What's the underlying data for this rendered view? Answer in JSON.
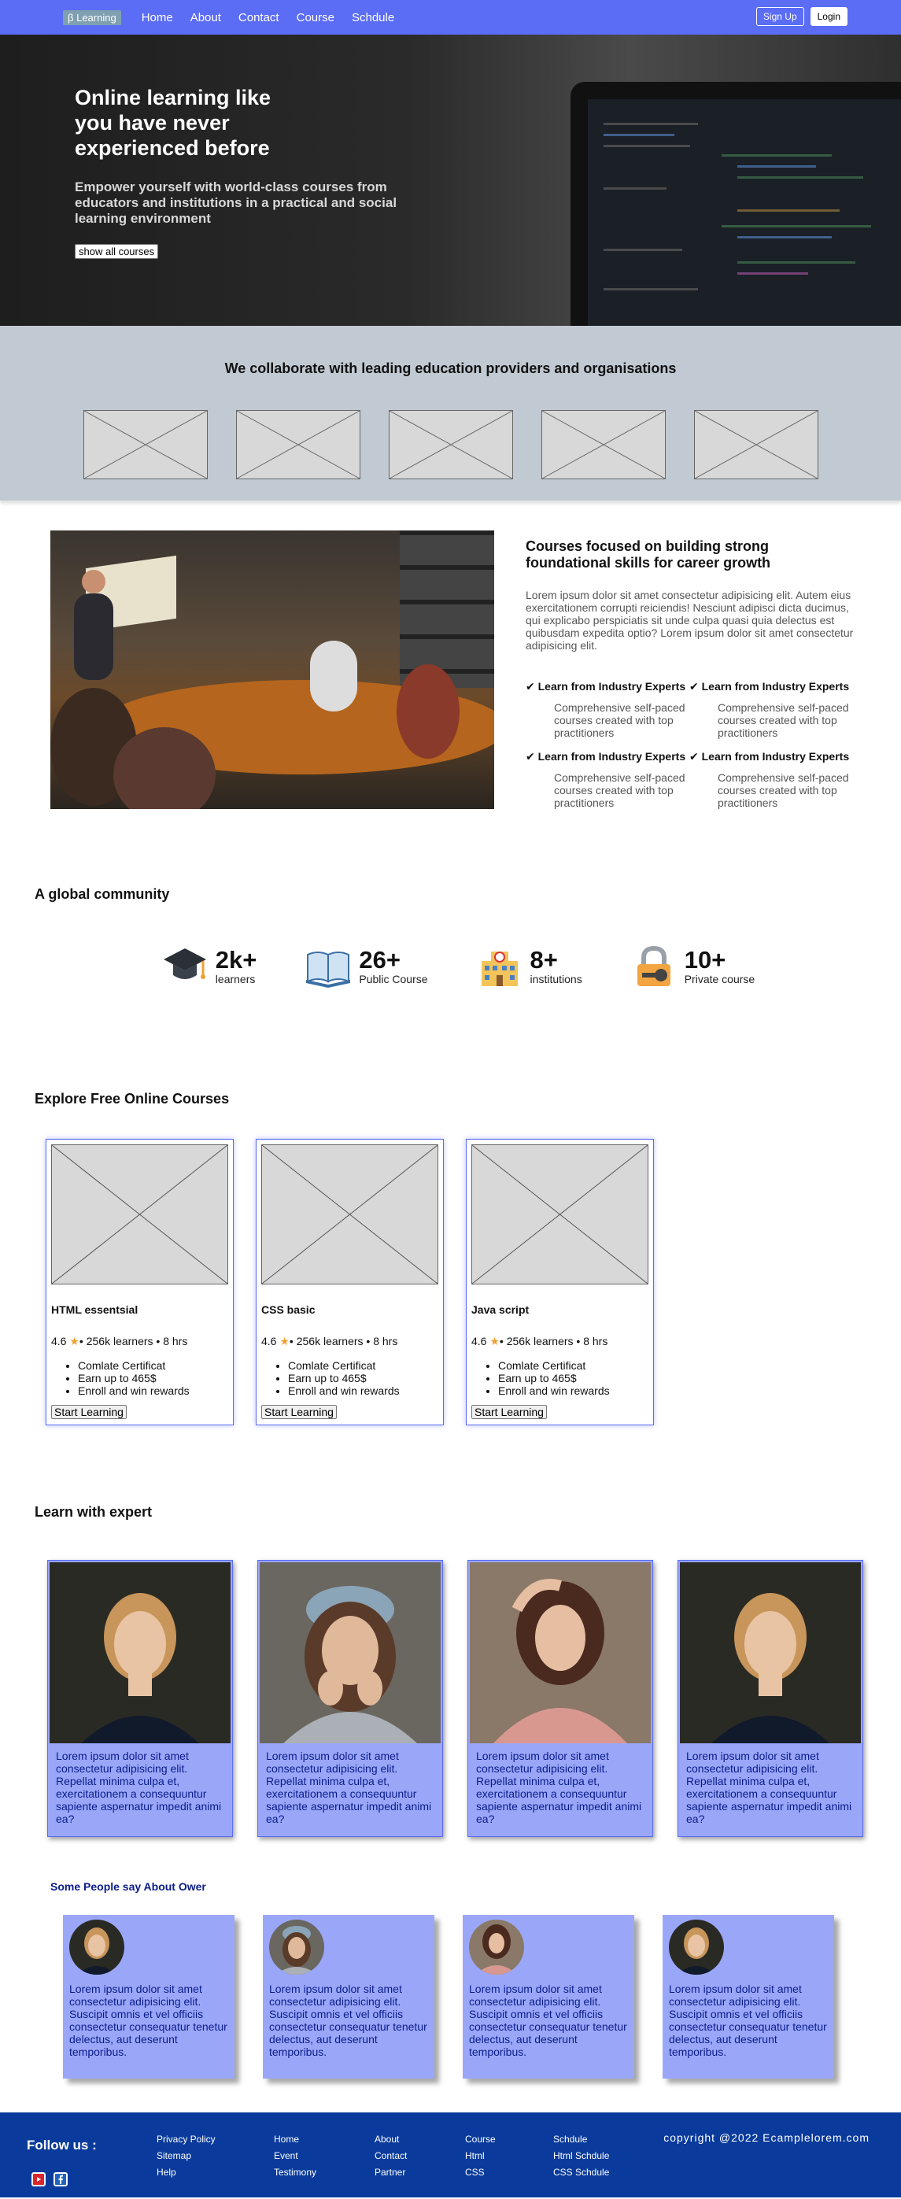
{
  "nav": {
    "logo": "β Learning",
    "links": [
      "Home",
      "About",
      "Contact",
      "Course",
      "Schdule"
    ],
    "signup": "Sign Up",
    "login": "Login"
  },
  "hero": {
    "title": "Online learning like you have never experienced before",
    "subtitle": "Empower yourself with world-class courses from educators and institutions in a practical and social learning environment",
    "button": "show all courses"
  },
  "partners": {
    "title": "We collaborate with leading education providers and organisations"
  },
  "focus": {
    "title": "Courses focused on building strong foundational skills for career growth",
    "paragraph": "Lorem ipsum dolor sit amet consectetur adipisicing elit. Autem eius exercitationem corrupti reiciendis! Nesciunt adipisci dicta ducimus, qui explicabo perspiciatis sit unde culpa quasi quia delectus est quibusdam expedita optio? Lorem ipsum dolor sit amet consectetur adipisicing elit.",
    "features": [
      {
        "title": "✔ Learn from Industry Experts",
        "desc": "Comprehensive self-paced courses created with top practitioners"
      },
      {
        "title": "✔ Learn from Industry Experts",
        "desc": "Comprehensive self-paced courses created with top practitioners"
      },
      {
        "title": "✔ Learn from Industry Experts",
        "desc": "Comprehensive self-paced courses created with top practitioners"
      },
      {
        "title": "✔ Learn from Industry Experts",
        "desc": "Comprehensive self-paced courses created with top practitioners"
      }
    ]
  },
  "community": {
    "title": "A global community",
    "stats": [
      {
        "num": "2k+",
        "label": "learners",
        "icon": "graduation-cap-icon"
      },
      {
        "num": "26+",
        "label": "Public Course",
        "icon": "open-book-icon"
      },
      {
        "num": "8+",
        "label": "institutions",
        "icon": "school-building-icon"
      },
      {
        "num": "10+",
        "label": "Private course",
        "icon": "locked-key-icon"
      }
    ]
  },
  "free_courses": {
    "title": "Explore Free Online Courses",
    "courses": [
      {
        "title": "HTML essentsial",
        "rating_pre": "4.6 ",
        "star": "★",
        "rating_post": "• 256k learners • 8 hrs",
        "perks": [
          "Comlate Certificat",
          "Earn up to 465$",
          "Enroll and win rewards"
        ],
        "button": "Start Learning"
      },
      {
        "title": "CSS basic",
        "rating_pre": "4.6 ",
        "star": "★",
        "rating_post": "• 256k learners • 8 hrs",
        "perks": [
          "Comlate Certificat",
          "Earn up to 465$",
          "Enroll and win rewards"
        ],
        "button": "Start Learning"
      },
      {
        "title": "Java script",
        "rating_pre": "4.6 ",
        "star": "★",
        "rating_post": "• 256k learners • 8 hrs",
        "perks": [
          "Comlate Certificat",
          "Earn up to 465$",
          "Enroll and win rewards"
        ],
        "button": "Start Learning"
      }
    ]
  },
  "expert": {
    "title": "Learn with expert",
    "cards": [
      {
        "text": "Lorem ipsum dolor sit amet consectetur adipisicing elit. Repellat minima culpa et, exercitationem a consequuntur sapiente aspernatur impedit animi ea?"
      },
      {
        "text": "Lorem ipsum dolor sit amet consectetur adipisicing elit. Repellat minima culpa et, exercitationem a consequuntur sapiente aspernatur impedit animi ea?"
      },
      {
        "text": "Lorem ipsum dolor sit amet consectetur adipisicing elit. Repellat minima culpa et, exercitationem a consequuntur sapiente aspernatur impedit animi ea?"
      },
      {
        "text": "Lorem ipsum dolor sit amet consectetur adipisicing elit. Repellat minima culpa et, exercitationem a consequuntur sapiente aspernatur impedit animi ea?"
      }
    ]
  },
  "testimonials": {
    "title": "Some People say About Ower",
    "cards": [
      {
        "text": "Lorem ipsum dolor sit amet consectetur adipisicing elit. Suscipit omnis et vel officiis consectetur consequatur tenetur delectus, aut deserunt temporibus."
      },
      {
        "text": "Lorem ipsum dolor sit amet consectetur adipisicing elit. Suscipit omnis et vel officiis consectetur consequatur tenetur delectus, aut deserunt temporibus."
      },
      {
        "text": "Lorem ipsum dolor sit amet consectetur adipisicing elit. Suscipit omnis et vel officiis consectetur consequatur tenetur delectus, aut deserunt temporibus."
      },
      {
        "text": "Lorem ipsum dolor sit amet consectetur adipisicing elit. Suscipit omnis et vel officiis consectetur consequatur tenetur delectus, aut deserunt temporibus."
      }
    ]
  },
  "footer": {
    "follow": "Follow us :",
    "columns": [
      [
        "Privacy Policy",
        "Sitemap",
        "Help"
      ],
      [
        "Home",
        "Event",
        "Testimony"
      ],
      [
        "About",
        "Contact",
        "Partner"
      ],
      [
        "Course",
        "Html",
        "CSS"
      ],
      [
        "Schdule",
        "Html Schdule",
        "CSS Schdule"
      ]
    ],
    "copyright": "copyright @2022 Ecamplelorem.com",
    "social_icons": [
      "youtube-icon",
      "facebook-icon"
    ]
  },
  "colors": {
    "nav": "#5b6cf5",
    "partners_bg": "#c1cad2",
    "card_bg": "#9aa7f8",
    "footer": "#0a3b9c",
    "text_blue": "#0b1c8a"
  }
}
